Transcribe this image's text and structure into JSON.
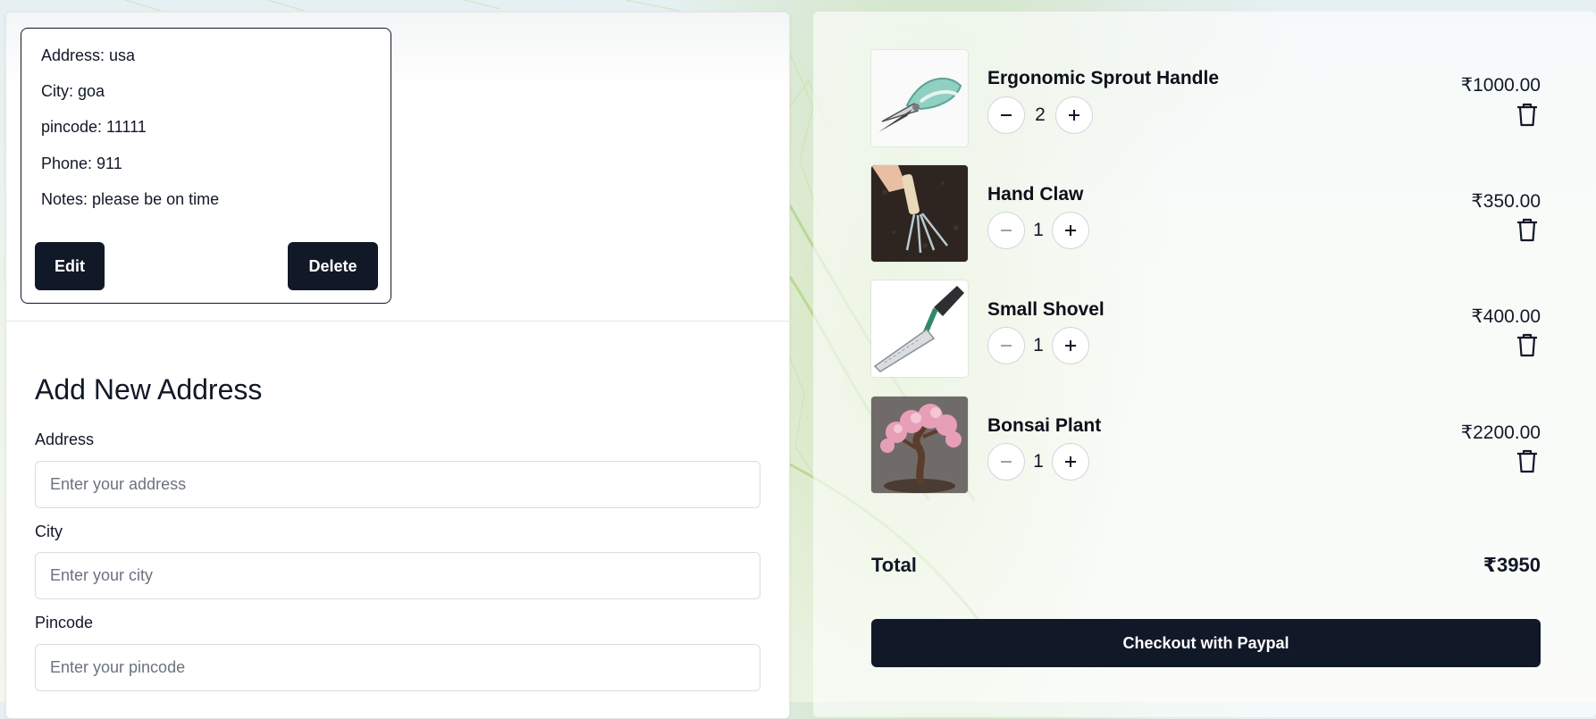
{
  "address_card": {
    "address": "Address: usa",
    "city": "City: goa",
    "pincode": "pincode: 11111",
    "phone": "Phone: 911",
    "notes": "Notes: please be on time",
    "edit_label": "Edit",
    "delete_label": "Delete"
  },
  "form": {
    "title": "Add New Address",
    "address_label": "Address",
    "address_placeholder": "Enter your address",
    "city_label": "City",
    "city_placeholder": "Enter your city",
    "pincode_label": "Pincode",
    "pincode_placeholder": "Enter your pincode"
  },
  "cart": {
    "items": [
      {
        "name": "Ergonomic Sprout Handle",
        "qty": "2",
        "price": "₹1000.00",
        "image": "pruner-image",
        "minus_enabled": true
      },
      {
        "name": "Hand Claw",
        "qty": "1",
        "price": "₹350.00",
        "image": "hand-claw-image",
        "minus_enabled": false
      },
      {
        "name": "Small Shovel",
        "qty": "1",
        "price": "₹400.00",
        "image": "small-shovel-image",
        "minus_enabled": false
      },
      {
        "name": "Bonsai Plant",
        "qty": "1",
        "price": "₹2200.00",
        "image": "bonsai-image",
        "minus_enabled": false
      }
    ],
    "total_label": "Total",
    "total_value": "₹3950",
    "checkout_label": "Checkout with Paypal"
  },
  "colors": {
    "primary_dark": "#111827",
    "disabled_icon": "#9ca3af"
  }
}
